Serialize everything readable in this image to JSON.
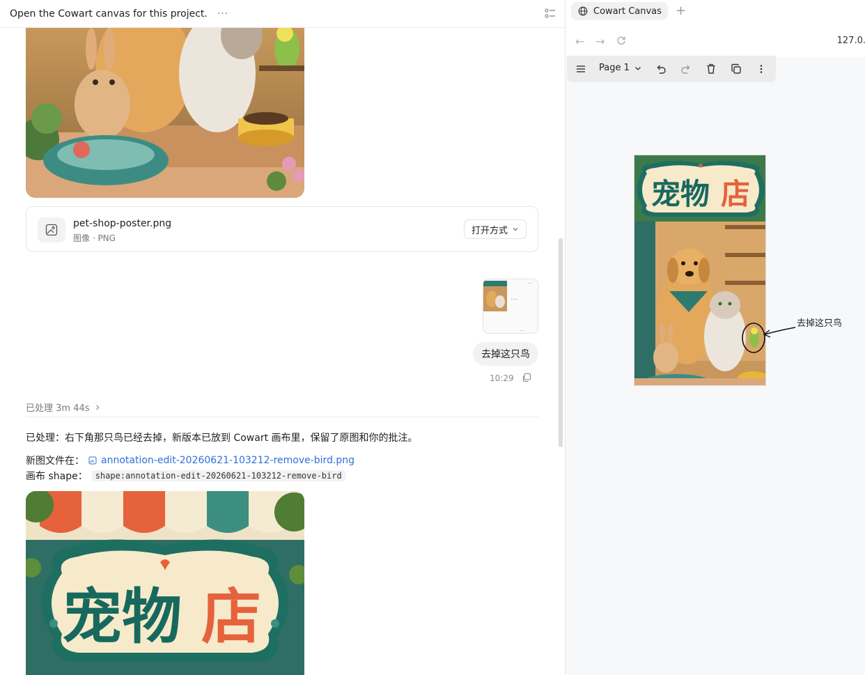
{
  "chat": {
    "title": "Open the Cowart canvas for this project.",
    "more_label": "···",
    "file": {
      "name": "pet-shop-poster.png",
      "meta": "图像 · PNG",
      "open_with": "打开方式"
    },
    "user_message": {
      "text": "去掉这只鸟",
      "time": "10:29"
    },
    "processed_label": "已处理 3m 44s",
    "response_text": "已处理：右下角那只鸟已经去掉，新版本已放到 Cowart 画布里，保留了原图和你的批注。",
    "new_file_label": "新图文件在：",
    "new_file_link": "annotation-edit-20260621-103212-remove-bird.png",
    "shape_label": "画布 shape：",
    "shape_value": "shape:annotation-edit-20260621-103212-remove-bird",
    "poster_sign_left": "宠物",
    "poster_sign_right": "店"
  },
  "browser": {
    "tab_title": "Cowart Canvas",
    "url": "127.0.",
    "page_label": "Page 1",
    "annotation_text": "去掉这只鸟",
    "poster_sign_left": "宠物",
    "poster_sign_right": "店"
  },
  "colors": {
    "link": "#2d6fd8",
    "sign_green": "#17695e",
    "sign_orange": "#e5623c"
  }
}
